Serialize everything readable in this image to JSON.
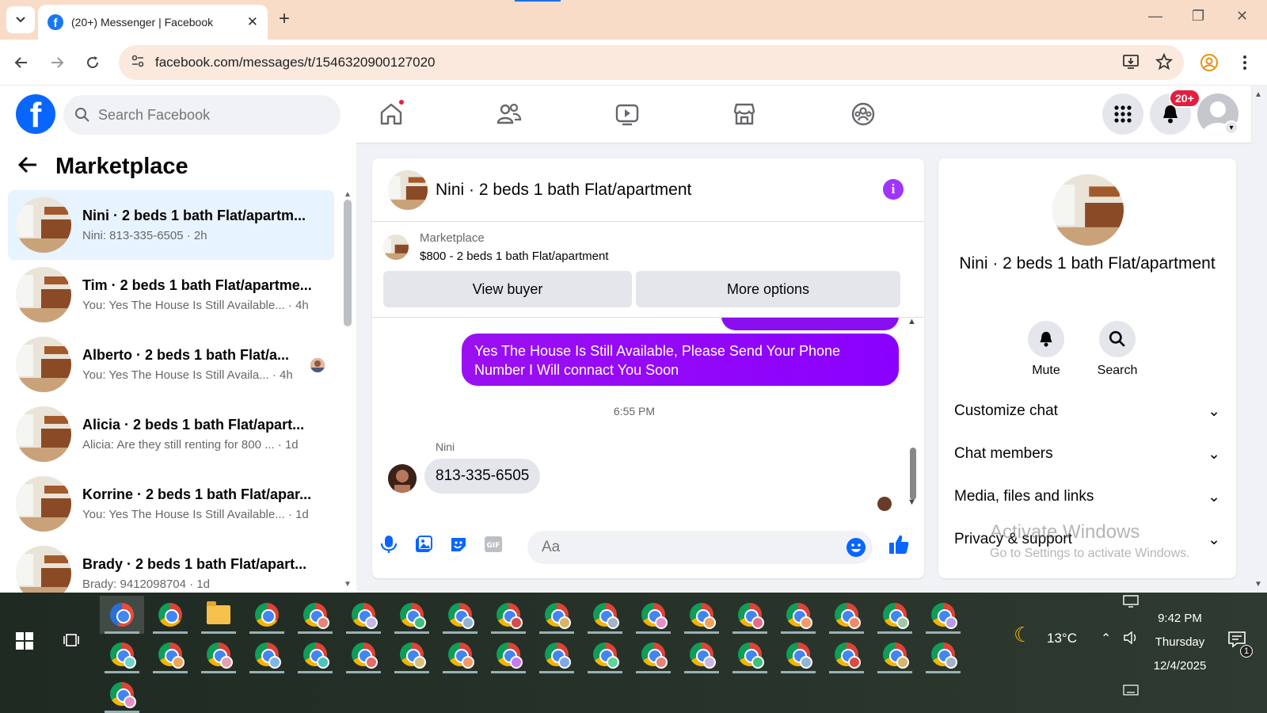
{
  "browser": {
    "tab_title": "(20+) Messenger | Facebook",
    "url": "facebook.com/messages/t/1546320900127020"
  },
  "fb": {
    "search_placeholder": "Search Facebook",
    "notifications_badge": "20+"
  },
  "left": {
    "title": "Marketplace",
    "conversations": [
      {
        "name": "Nini · 2 beds 1 bath Flat/apartm...",
        "preview": "Nini: 813-335-6505 · 2h"
      },
      {
        "name": "Tim · 2 beds 1 bath Flat/apartme...",
        "preview": "You: Yes The House Is Still Available... · 4h"
      },
      {
        "name": "Alberto · 2 beds 1 bath Flat/a...",
        "preview": "You: Yes The House Is Still Availa... · 4h"
      },
      {
        "name": "Alicia · 2 beds 1 bath Flat/apart...",
        "preview": "Alicia: Are they still renting for 800 ... · 1d"
      },
      {
        "name": "Korrine · 2 beds 1 bath Flat/apar...",
        "preview": "You: Yes The House Is Still Available... · 1d"
      },
      {
        "name": "Brady · 2 beds 1 bath Flat/apart...",
        "preview": "Brady: 9412098704 · 1d"
      }
    ]
  },
  "chat": {
    "title": "Nini · 2 beds 1 bath Flat/apartment",
    "marketplace_label": "Marketplace",
    "listing": "$800 - 2 beds 1 bath Flat/apartment",
    "view_buyer": "View buyer",
    "more_options": "More options",
    "outgoing_message": "Yes The House Is Still Available, Please Send Your Phone Number I Will connact You Soon",
    "timestamp": "6:55 PM",
    "sender": "Nini",
    "incoming_message": "813-335-6505",
    "composer_placeholder": "Aa"
  },
  "right": {
    "title": "Nini · 2 beds 1 bath Flat/apartment",
    "mute": "Mute",
    "search": "Search",
    "sections": [
      "Customize chat",
      "Chat members",
      "Media, files and links",
      "Privacy & support"
    ]
  },
  "watermark": {
    "line1": "Activate Windows",
    "line2": "Go to Settings to activate Windows."
  },
  "taskbar": {
    "temperature": "13°C",
    "time": "9:42 PM",
    "day": "Thursday",
    "date": "12/4/2025",
    "notification_count": "1"
  }
}
